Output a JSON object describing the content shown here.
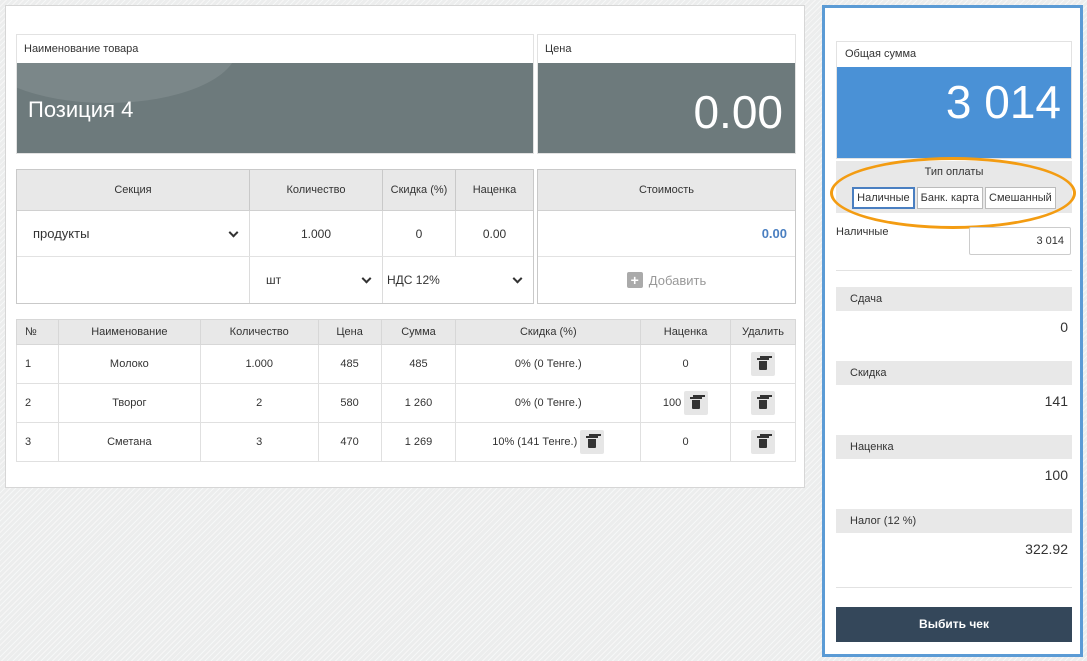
{
  "product": {
    "name_label": "Наименование товара",
    "name_value": "Позиция 4",
    "price_label": "Цена",
    "price_value": "0.00"
  },
  "section_table": {
    "headers": {
      "section": "Секция",
      "quantity": "Количество",
      "discount": "Скидка (%)",
      "markup": "Наценка",
      "cost": "Стоимость"
    },
    "section_value": "продукты",
    "quantity_value": "1.000",
    "discount_value": "0",
    "markup_value": "0.00",
    "cost_value": "0.00",
    "unit_value": "шт",
    "vat_value": "НДС 12%",
    "add_label": "Добавить"
  },
  "items": {
    "headers": [
      "№",
      "Наименование",
      "Количество",
      "Цена",
      "Сумма",
      "Скидка (%)",
      "Наценка",
      "Удалить"
    ],
    "rows": [
      {
        "n": "1",
        "name": "Молоко",
        "qty": "1.000",
        "price": "485",
        "sum": "485",
        "discount": "0% (0 Тенге.)",
        "markup": "0"
      },
      {
        "n": "2",
        "name": "Творог",
        "qty": "2",
        "price": "580",
        "sum": "1 260",
        "discount": "0% (0 Тенге.)",
        "markup": "100"
      },
      {
        "n": "3",
        "name": "Сметана",
        "qty": "3",
        "price": "470",
        "sum": "1 269",
        "discount": "10% (141 Тенге.)",
        "markup": "0"
      }
    ]
  },
  "summary": {
    "total_label": "Общая сумма",
    "total_value": "3 014",
    "payment_type_label": "Тип оплаты",
    "payment_options": [
      "Наличные",
      "Банк. карта",
      "Смешанный"
    ],
    "payment_selected": "Наличные",
    "cash_label": "Наличные",
    "cash_value": "3 014",
    "change_label": "Сдача",
    "change_value": "0",
    "discount_label": "Скидка",
    "discount_value": "141",
    "markup_label": "Наценка",
    "markup_value": "100",
    "tax_label": "Налог (12 %)",
    "tax_value": "322.92",
    "print_label": "Выбить чек"
  },
  "colors": {
    "total_display": "#4a91d6",
    "product_display": "#6d7a7c",
    "highlight": "#f39c12",
    "print_button": "#34475a",
    "panel_border": "#5b9bd5"
  }
}
